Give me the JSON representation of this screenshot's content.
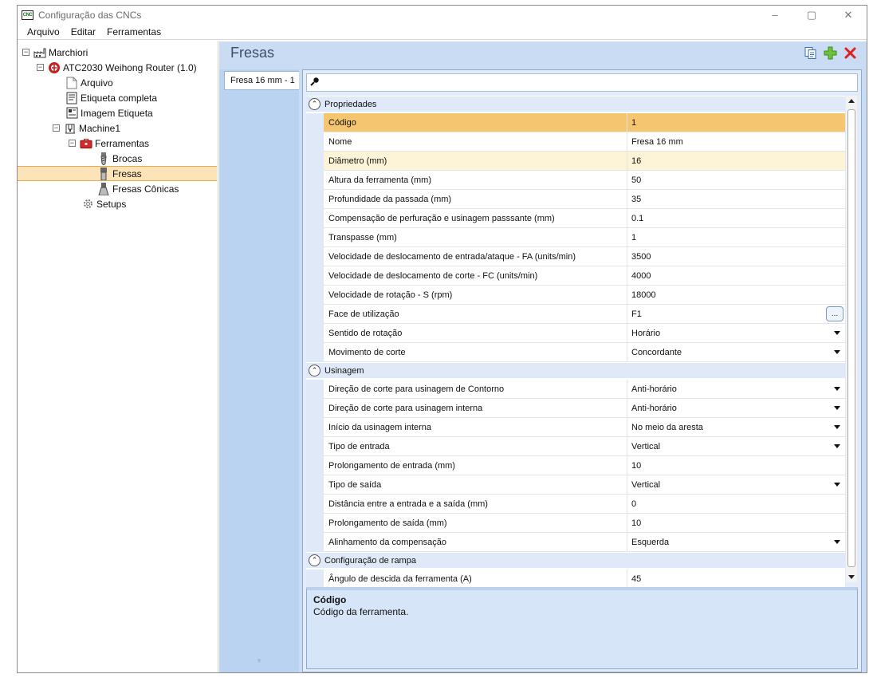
{
  "window": {
    "app_icon_text": "CNC",
    "title": "Configuração das CNCs",
    "controls": {
      "minimize": "–",
      "restore": "▢",
      "close": "✕"
    }
  },
  "menu": [
    "Arquivo",
    "Editar",
    "Ferramentas"
  ],
  "tree": [
    {
      "label": "Marchiori",
      "icon": "factory-icon",
      "expander": "⊟",
      "depth": 0
    },
    {
      "label": "ATC2030 Weihong Router (1.0)",
      "icon": "machine-logo-icon",
      "expander": "⊟",
      "depth": 1
    },
    {
      "label": "Arquivo",
      "icon": "file-icon",
      "depth": 2
    },
    {
      "label": "Etiqueta completa",
      "icon": "label-icon",
      "depth": 2
    },
    {
      "label": "Imagem Etiqueta",
      "icon": "label-image-icon",
      "depth": 2
    },
    {
      "label": "Machine1",
      "icon": "cnc-machine-icon",
      "expander": "⊟",
      "depth": 2
    },
    {
      "label": "Ferramentas",
      "icon": "toolbox-icon",
      "expander": "⊟",
      "depth": 3
    },
    {
      "label": "Brocas",
      "icon": "drill-bit-icon",
      "depth": 4
    },
    {
      "label": "Fresas",
      "icon": "mill-bit-icon",
      "depth": 4,
      "selected": true
    },
    {
      "label": "Fresas Cônicas",
      "icon": "conical-mill-icon",
      "depth": 4
    },
    {
      "label": "Setups",
      "icon": "gear-icon",
      "depth": 3
    }
  ],
  "main": {
    "title": "Fresas",
    "header_icons": [
      "copy-icon",
      "add-icon",
      "delete-icon"
    ],
    "tab_label": "Fresa 16 mm - 1"
  },
  "grid": {
    "categories": [
      {
        "label": "Propriedades",
        "rows": [
          {
            "name": "Código",
            "value": "1",
            "state": "selected"
          },
          {
            "name": "Nome",
            "value": "Fresa 16 mm"
          },
          {
            "name": "Diâmetro (mm)",
            "value": "16",
            "state": "hover"
          },
          {
            "name": "Altura da ferramenta (mm)",
            "value": "50"
          },
          {
            "name": "Profundidade da passada (mm)",
            "value": "35"
          },
          {
            "name": "Compensação de perfuração e usinagem passsante (mm)",
            "value": "0.1"
          },
          {
            "name": "Transpasse (mm)",
            "value": "1"
          },
          {
            "name": "Velocidade de deslocamento de entrada/ataque - FA (units/min)",
            "value": "3500"
          },
          {
            "name": "Velocidade de deslocamento de corte - FC (units/min)",
            "value": "4000"
          },
          {
            "name": "Velocidade de rotação - S (rpm)",
            "value": "18000"
          },
          {
            "name": "Face de utilização",
            "value": "F1",
            "editor": "ellipsis"
          },
          {
            "name": "Sentido de rotação",
            "value": "Horário",
            "editor": "dropdown"
          },
          {
            "name": "Movimento de corte",
            "value": "Concordante",
            "editor": "dropdown"
          }
        ]
      },
      {
        "label": "Usinagem",
        "rows": [
          {
            "name": "Direção de corte para usinagem de Contorno",
            "value": "Anti-horário",
            "editor": "dropdown"
          },
          {
            "name": "Direção de corte para usinagem interna",
            "value": "Anti-horário",
            "editor": "dropdown"
          },
          {
            "name": "Início da usinagem interna",
            "value": "No meio da aresta",
            "editor": "dropdown"
          },
          {
            "name": "Tipo de entrada",
            "value": "Vertical",
            "editor": "dropdown"
          },
          {
            "name": "Prolongamento de entrada (mm)",
            "value": "10"
          },
          {
            "name": "Tipo de saída",
            "value": "Vertical",
            "editor": "dropdown"
          },
          {
            "name": "Distância entre a entrada e a saída (mm)",
            "value": "0"
          },
          {
            "name": "Prolongamento de saída (mm)",
            "value": "10"
          },
          {
            "name": "Alinhamento da compensação",
            "value": "Esquerda",
            "editor": "dropdown"
          }
        ]
      },
      {
        "label": "Configuração de rampa",
        "rows": [
          {
            "name": "Ângulo de descida da ferramenta (A)",
            "value": "45"
          }
        ]
      }
    ],
    "ellipsis_label": "..."
  },
  "description": {
    "title": "Código",
    "text": "Código da ferramenta."
  }
}
